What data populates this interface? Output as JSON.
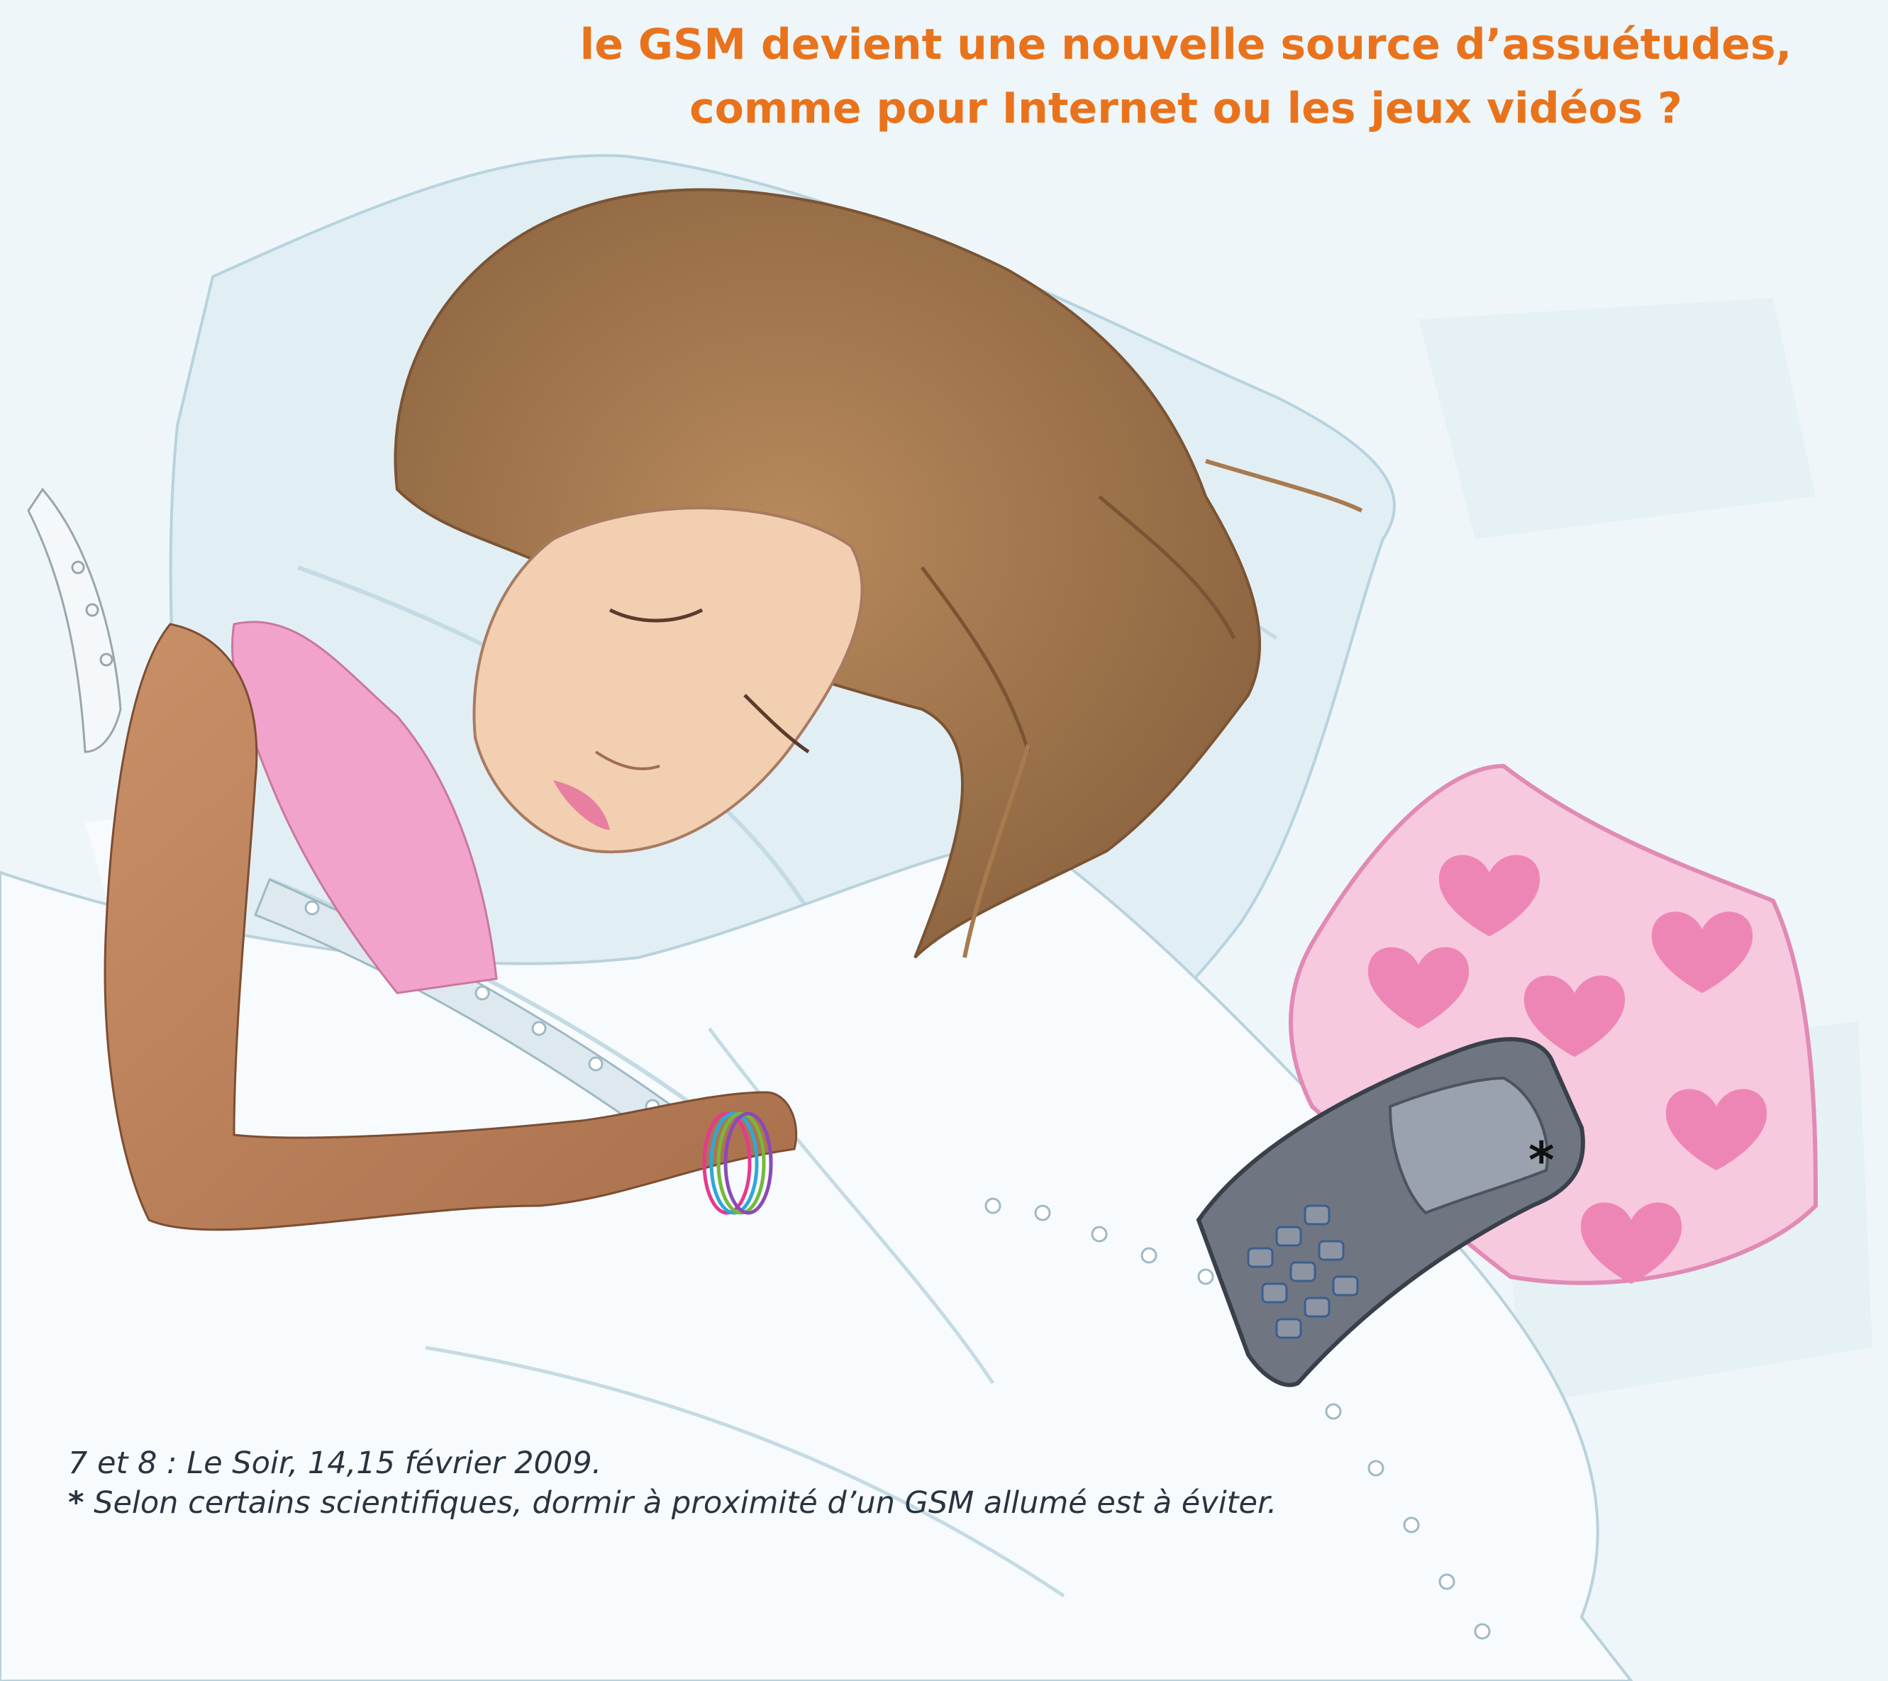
{
  "headline": {
    "line1": "le GSM devient une nouvelle source d’assuétudes,",
    "line2": "comme pour Internet ou les jeux vidéos ?"
  },
  "phone_marker": "*",
  "footnotes": {
    "source": "7 et 8 : Le Soir, 14,15 février 2009.",
    "asterisk": "*",
    "note": "Selon certains scientifiques, dormir à proximité d’un GSM allumé est à éviter."
  },
  "colors": {
    "headline": "#e9731c",
    "background": "#eef6f9",
    "pillow": "#f3b8d6",
    "top": "#f2a3cc",
    "hair": "#a87a4e",
    "skin": "#f2cfb1",
    "phone": "#6f7682"
  },
  "icons": [
    "heart-icon",
    "asterisk-icon"
  ]
}
